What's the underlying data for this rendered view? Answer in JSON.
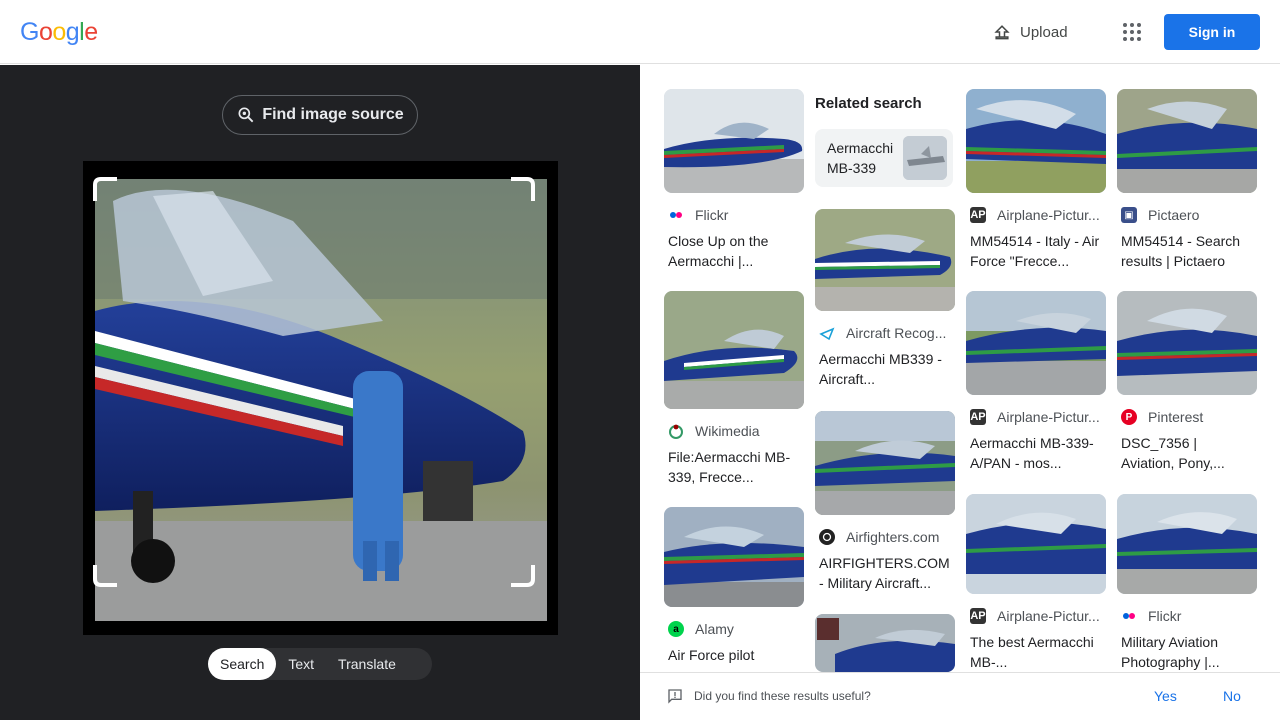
{
  "header": {
    "logo": [
      "G",
      "o",
      "o",
      "g",
      "l",
      "e"
    ],
    "logo_colors": [
      "#4285F4",
      "#EA4335",
      "#FBBC05",
      "#4285F4",
      "#34A853",
      "#EA4335"
    ],
    "upload_label": "Upload",
    "signin_label": "Sign in"
  },
  "left": {
    "find_source_label": "Find image source",
    "tabs": [
      {
        "label": "Search",
        "active": true
      },
      {
        "label": "Text",
        "active": false
      },
      {
        "label": "Translate",
        "active": false
      }
    ]
  },
  "right": {
    "related_label": "Related search",
    "related_chip": "Aermacchi MB-339",
    "results": [
      {
        "source": "Flickr",
        "title": "Close Up on the Aermacchi |...",
        "icon": "flickr-icon"
      },
      {
        "source": "Aircraft Recog...",
        "title": "Aermacchi MB339 - Aircraft...",
        "icon": "aircraft-recog-icon"
      },
      {
        "source": "Airplane-Pictur...",
        "title": "MM54514 - Italy - Air Force \"Frecce...",
        "icon": "airplane-pictures-icon"
      },
      {
        "source": "Pictaero",
        "title": "MM54514 - Search results | Pictaero",
        "icon": "pictaero-icon"
      },
      {
        "source": "Wikimedia",
        "title": "File:Aermacchi MB-339, Frecce...",
        "icon": "wikimedia-icon"
      },
      {
        "source": "Airfighters.com",
        "title": "AIRFIGHTERS.COM - Military Aircraft...",
        "icon": "airfighters-icon"
      },
      {
        "source": "Airplane-Pictur...",
        "title": "Aermacchi MB-339-A/PAN - mos...",
        "icon": "airplane-pictures-icon"
      },
      {
        "source": "Pinterest",
        "title": "DSC_7356 | Aviation, Pony,...",
        "icon": "pinterest-icon"
      },
      {
        "source": "Alamy",
        "title": "Air Force pilot",
        "icon": "alamy-icon"
      },
      {
        "source": "Airplane-Pictur...",
        "title": "The best Aermacchi MB-...",
        "icon": "airplane-pictures-icon"
      },
      {
        "source": "Flickr",
        "title": "Military Aviation Photography |...",
        "icon": "flickr-icon"
      }
    ]
  },
  "feedback": {
    "question": "Did you find these results useful?",
    "yes": "Yes",
    "no": "No"
  }
}
